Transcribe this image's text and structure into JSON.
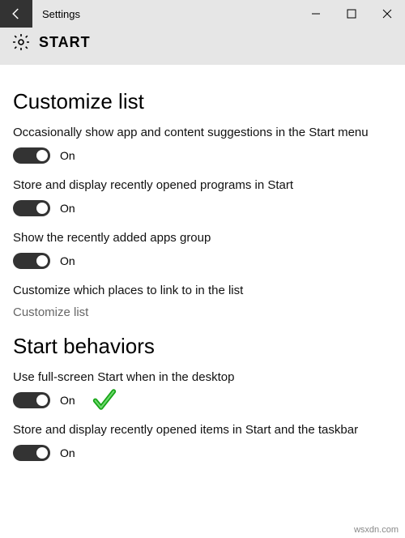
{
  "titlebar": {
    "title": "Settings"
  },
  "header": {
    "title": "START"
  },
  "sections": {
    "customize": {
      "title": "Customize list",
      "options": [
        {
          "label": "Occasionally show app and content suggestions in the Start menu",
          "state": "On"
        },
        {
          "label": "Store and display recently opened programs in Start",
          "state": "On"
        },
        {
          "label": "Show the recently added apps group",
          "state": "On"
        }
      ],
      "linkIntro": "Customize which places to link to in the list",
      "linkLabel": "Customize list"
    },
    "behaviors": {
      "title": "Start behaviors",
      "options": [
        {
          "label": "Use full-screen Start when in the desktop",
          "state": "On"
        },
        {
          "label": "Store and display recently opened items in Start and the taskbar",
          "state": "On"
        }
      ]
    }
  },
  "watermark": "wsxdn.com"
}
